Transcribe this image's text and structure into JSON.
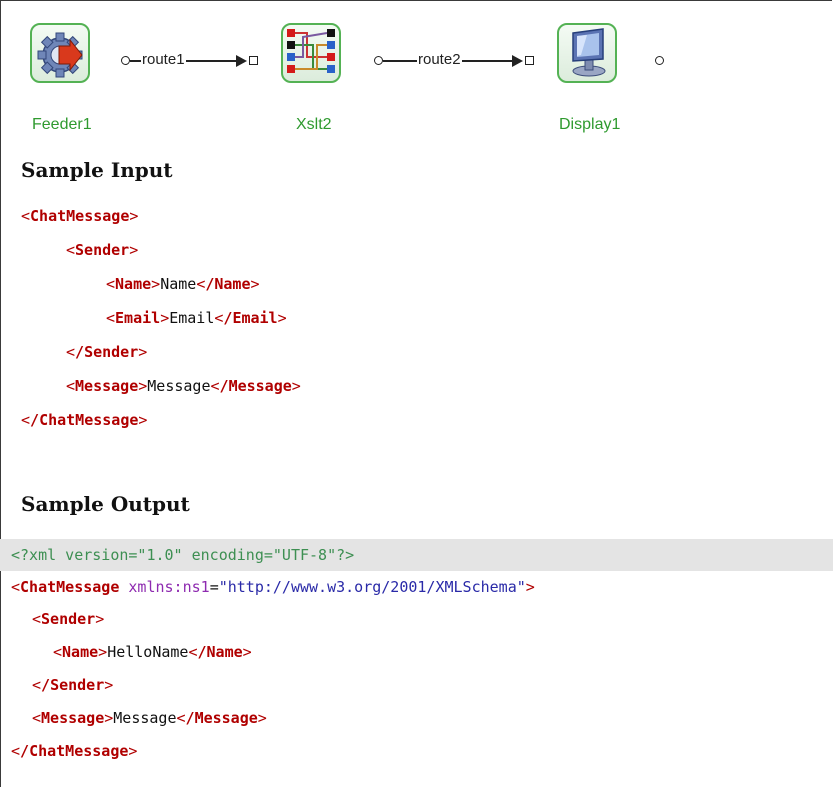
{
  "flow": {
    "nodes": [
      {
        "label": "Feeder1",
        "icon": "feeder-gear-icon"
      },
      {
        "label": "Xslt2",
        "icon": "xslt-transform-icon"
      },
      {
        "label": "Display1",
        "icon": "display-monitor-icon"
      }
    ],
    "routes": [
      {
        "label": "route1"
      },
      {
        "label": "route2"
      }
    ]
  },
  "sample_input": {
    "heading": "Sample Input",
    "root_tag": "ChatMessage",
    "sender_tag": "Sender",
    "name_tag": "Name",
    "name_value": "Name",
    "email_tag": "Email",
    "email_value": "Email",
    "message_tag": "Message",
    "message_value": "Message"
  },
  "sample_output": {
    "heading": "Sample Output",
    "declaration": "<?xml version=\"1.0\" encoding=\"UTF-8\"?>",
    "root_tag": "ChatMessage",
    "ns_attr": "xmlns:ns1",
    "ns_value": "\"http://www.w3.org/2001/XMLSchema\"",
    "sender_tag": "Sender",
    "name_tag": "Name",
    "name_value": "HelloName",
    "message_tag": "Message",
    "message_value": "Message"
  },
  "colors": {
    "node_border": "#54b254",
    "node_label": "#2f9a2f",
    "xml_tag": "#b00000",
    "xml_attr": "#8e2bb0",
    "xml_value": "#2a2aa8",
    "xml_declaration": "#3d8f52"
  }
}
